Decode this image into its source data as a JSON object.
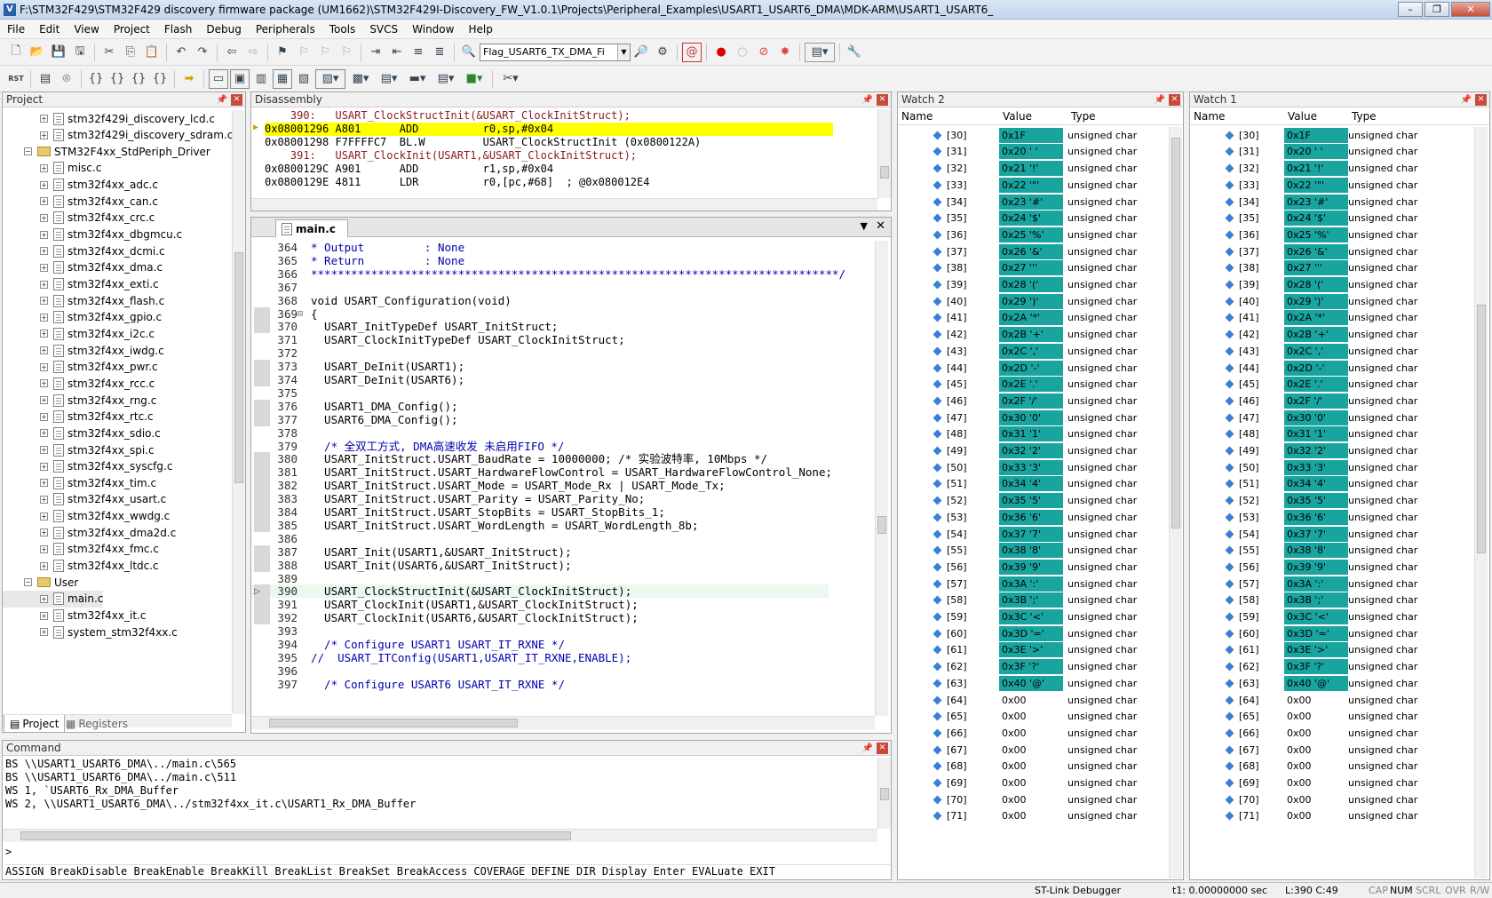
{
  "title": "F:\\STM32F429\\STM32F429 discovery firmware package (UM1662)\\STM32F429I-Discovery_FW_V1.0.1\\Projects\\Peripheral_Examples\\USART1_USART6_DMA\\MDK-ARM\\USART1_USART6_",
  "menu": [
    "File",
    "Edit",
    "View",
    "Project",
    "Flash",
    "Debug",
    "Peripherals",
    "Tools",
    "SVCS",
    "Window",
    "Help"
  ],
  "toolbar": {
    "target_combo": "Flag_USART6_TX_DMA_Fi",
    "rst_label": "RST"
  },
  "project": {
    "header": "Project",
    "items": [
      {
        "label": "stm32f429i_discovery_lcd.c",
        "kind": "file",
        "level": 2
      },
      {
        "label": "stm32f429i_discovery_sdram.c",
        "kind": "file",
        "level": 2
      },
      {
        "label": "STM32F4xx_StdPeriph_Driver",
        "kind": "folder",
        "level": 1
      },
      {
        "label": "misc.c",
        "kind": "file",
        "level": 2
      },
      {
        "label": "stm32f4xx_adc.c",
        "kind": "file",
        "level": 2
      },
      {
        "label": "stm32f4xx_can.c",
        "kind": "file",
        "level": 2
      },
      {
        "label": "stm32f4xx_crc.c",
        "kind": "file",
        "level": 2
      },
      {
        "label": "stm32f4xx_dbgmcu.c",
        "kind": "file",
        "level": 2
      },
      {
        "label": "stm32f4xx_dcmi.c",
        "kind": "file",
        "level": 2
      },
      {
        "label": "stm32f4xx_dma.c",
        "kind": "file",
        "level": 2
      },
      {
        "label": "stm32f4xx_exti.c",
        "kind": "file",
        "level": 2
      },
      {
        "label": "stm32f4xx_flash.c",
        "kind": "file",
        "level": 2
      },
      {
        "label": "stm32f4xx_gpio.c",
        "kind": "file",
        "level": 2
      },
      {
        "label": "stm32f4xx_i2c.c",
        "kind": "file",
        "level": 2
      },
      {
        "label": "stm32f4xx_iwdg.c",
        "kind": "file",
        "level": 2
      },
      {
        "label": "stm32f4xx_pwr.c",
        "kind": "file",
        "level": 2
      },
      {
        "label": "stm32f4xx_rcc.c",
        "kind": "file",
        "level": 2
      },
      {
        "label": "stm32f4xx_rng.c",
        "kind": "file",
        "level": 2
      },
      {
        "label": "stm32f4xx_rtc.c",
        "kind": "file",
        "level": 2
      },
      {
        "label": "stm32f4xx_sdio.c",
        "kind": "file",
        "level": 2
      },
      {
        "label": "stm32f4xx_spi.c",
        "kind": "file",
        "level": 2
      },
      {
        "label": "stm32f4xx_syscfg.c",
        "kind": "file",
        "level": 2
      },
      {
        "label": "stm32f4xx_tim.c",
        "kind": "file",
        "level": 2
      },
      {
        "label": "stm32f4xx_usart.c",
        "kind": "file",
        "level": 2
      },
      {
        "label": "stm32f4xx_wwdg.c",
        "kind": "file",
        "level": 2
      },
      {
        "label": "stm32f4xx_dma2d.c",
        "kind": "file",
        "level": 2
      },
      {
        "label": "stm32f4xx_fmc.c",
        "kind": "file",
        "level": 2
      },
      {
        "label": "stm32f4xx_ltdc.c",
        "kind": "file",
        "level": 2
      },
      {
        "label": "User",
        "kind": "folder",
        "level": 1
      },
      {
        "label": "main.c",
        "kind": "file",
        "level": 2
      },
      {
        "label": "stm32f4xx_it.c",
        "kind": "file",
        "level": 2
      },
      {
        "label": "system_stm32f4xx.c",
        "kind": "file",
        "level": 2
      }
    ],
    "tab_project": "Project",
    "tab_registers": "Registers"
  },
  "disassembly": {
    "header": "Disassembly",
    "lines": [
      {
        "text": "    390:   USART_ClockStructInit(&USART_ClockInitStruct);",
        "src": true,
        "hl": false
      },
      {
        "text": "0x08001296 A801      ADD          r0,sp,#0x04",
        "src": false,
        "hl": true
      },
      {
        "text": "0x08001298 F7FFFFC7  BL.W         USART_ClockStructInit (0x0800122A)",
        "src": false,
        "hl": false
      },
      {
        "text": "    391:   USART_ClockInit(USART1,&USART_ClockInitStruct);",
        "src": true,
        "hl": false
      },
      {
        "text": "0x0800129C A901      ADD          r1,sp,#0x04",
        "src": false,
        "hl": false
      },
      {
        "text": "0x0800129E 4811      LDR          r0,[pc,#68]  ; @0x080012E4",
        "src": false,
        "hl": false
      }
    ]
  },
  "editor": {
    "tab": "main.c",
    "lines": [
      {
        "n": "364",
        "t": "* Output         : None",
        "c": "#0000b0"
      },
      {
        "n": "365",
        "t": "* Return         : None",
        "c": "#0000b0"
      },
      {
        "n": "366",
        "t": "*******************************************************************************/",
        "c": "#0000b0"
      },
      {
        "n": "367",
        "t": "",
        "c": "#000"
      },
      {
        "n": "368",
        "t": "void USART_Configuration(void)",
        "c": "#000"
      },
      {
        "n": "369",
        "t": "{",
        "c": "#000"
      },
      {
        "n": "370",
        "t": "  USART_InitTypeDef USART_InitStruct;",
        "c": "#000"
      },
      {
        "n": "371",
        "t": "  USART_ClockInitTypeDef USART_ClockInitStruct;",
        "c": "#000"
      },
      {
        "n": "372",
        "t": "",
        "c": "#000"
      },
      {
        "n": "373",
        "t": "  USART_DeInit(USART1);",
        "c": "#000"
      },
      {
        "n": "374",
        "t": "  USART_DeInit(USART6);",
        "c": "#000"
      },
      {
        "n": "375",
        "t": "",
        "c": "#000"
      },
      {
        "n": "376",
        "t": "  USART1_DMA_Config();",
        "c": "#000"
      },
      {
        "n": "377",
        "t": "  USART6_DMA_Config();",
        "c": "#000"
      },
      {
        "n": "378",
        "t": "",
        "c": "#000"
      },
      {
        "n": "379",
        "t": "  /* 全双工方式, DMA高速收发 未启用FIFO */",
        "c": "#0000b0"
      },
      {
        "n": "380",
        "t": "  USART_InitStruct.USART_BaudRate = 10000000; /* 实验波特率, 10Mbps */",
        "c": "#000"
      },
      {
        "n": "381",
        "t": "  USART_InitStruct.USART_HardwareFlowControl = USART_HardwareFlowControl_None;",
        "c": "#000"
      },
      {
        "n": "382",
        "t": "  USART_InitStruct.USART_Mode = USART_Mode_Rx | USART_Mode_Tx;",
        "c": "#000"
      },
      {
        "n": "383",
        "t": "  USART_InitStruct.USART_Parity = USART_Parity_No;",
        "c": "#000"
      },
      {
        "n": "384",
        "t": "  USART_InitStruct.USART_StopBits = USART_StopBits_1;",
        "c": "#000"
      },
      {
        "n": "385",
        "t": "  USART_InitStruct.USART_WordLength = USART_WordLength_8b;",
        "c": "#000"
      },
      {
        "n": "386",
        "t": "",
        "c": "#000"
      },
      {
        "n": "387",
        "t": "  USART_Init(USART1,&USART_InitStruct);",
        "c": "#000"
      },
      {
        "n": "388",
        "t": "  USART_Init(USART6,&USART_InitStruct);",
        "c": "#000"
      },
      {
        "n": "389",
        "t": "",
        "c": "#000"
      },
      {
        "n": "390",
        "t": "  USART_ClockStructInit(&USART_ClockInitStruct);",
        "c": "#000"
      },
      {
        "n": "391",
        "t": "  USART_ClockInit(USART1,&USART_ClockInitStruct);",
        "c": "#000"
      },
      {
        "n": "392",
        "t": "  USART_ClockInit(USART6,&USART_ClockInitStruct);",
        "c": "#000"
      },
      {
        "n": "393",
        "t": "",
        "c": "#000"
      },
      {
        "n": "394",
        "t": "  /* Configure USART1 USART_IT_RXNE */",
        "c": "#0000b0"
      },
      {
        "n": "395",
        "t": "//  USART_ITConfig(USART1,USART_IT_RXNE,ENABLE);",
        "c": "#0000b0"
      },
      {
        "n": "396",
        "t": "",
        "c": "#000"
      },
      {
        "n": "397",
        "t": "  /* Configure USART6 USART_IT_RXNE */",
        "c": "#0000b0"
      }
    ]
  },
  "command": {
    "header": "Command",
    "lines": [
      "BS \\\\USART1_USART6_DMA\\../main.c\\565",
      "BS \\\\USART1_USART6_DMA\\../main.c\\511",
      "WS 1, `USART6_Rx_DMA_Buffer",
      "WS 2, \\\\USART1_USART6_DMA\\../stm32f4xx_it.c\\USART1_Rx_DMA_Buffer"
    ],
    "prompt": ">",
    "help": "ASSIGN BreakDisable BreakEnable BreakKill BreakList BreakSet BreakAccess COVERAGE DEFINE DIR Display Enter EVALuate EXIT"
  },
  "watch2": {
    "header": "Watch 2",
    "col_name": "Name",
    "col_value": "Value",
    "col_type": "Type"
  },
  "watch1": {
    "header": "Watch 1",
    "col_name": "Name",
    "col_value": "Value",
    "col_type": "Type"
  },
  "watch_rows": [
    {
      "i": "[30]",
      "v": "0x1F",
      "t": "unsigned char",
      "ch": true
    },
    {
      "i": "[31]",
      "v": "0x20 ' '",
      "t": "unsigned char",
      "ch": true
    },
    {
      "i": "[32]",
      "v": "0x21 '!'",
      "t": "unsigned char",
      "ch": true
    },
    {
      "i": "[33]",
      "v": "0x22 '\"'",
      "t": "unsigned char",
      "ch": true
    },
    {
      "i": "[34]",
      "v": "0x23 '#'",
      "t": "unsigned char",
      "ch": true
    },
    {
      "i": "[35]",
      "v": "0x24 '$'",
      "t": "unsigned char",
      "ch": true
    },
    {
      "i": "[36]",
      "v": "0x25 '%'",
      "t": "unsigned char",
      "ch": true
    },
    {
      "i": "[37]",
      "v": "0x26 '&'",
      "t": "unsigned char",
      "ch": true
    },
    {
      "i": "[38]",
      "v": "0x27 '''",
      "t": "unsigned char",
      "ch": true
    },
    {
      "i": "[39]",
      "v": "0x28 '('",
      "t": "unsigned char",
      "ch": true
    },
    {
      "i": "[40]",
      "v": "0x29 ')'",
      "t": "unsigned char",
      "ch": true
    },
    {
      "i": "[41]",
      "v": "0x2A '*'",
      "t": "unsigned char",
      "ch": true
    },
    {
      "i": "[42]",
      "v": "0x2B '+'",
      "t": "unsigned char",
      "ch": true
    },
    {
      "i": "[43]",
      "v": "0x2C ','",
      "t": "unsigned char",
      "ch": true
    },
    {
      "i": "[44]",
      "v": "0x2D '-'",
      "t": "unsigned char",
      "ch": true
    },
    {
      "i": "[45]",
      "v": "0x2E '.'",
      "t": "unsigned char",
      "ch": true
    },
    {
      "i": "[46]",
      "v": "0x2F '/'",
      "t": "unsigned char",
      "ch": true
    },
    {
      "i": "[47]",
      "v": "0x30 '0'",
      "t": "unsigned char",
      "ch": true
    },
    {
      "i": "[48]",
      "v": "0x31 '1'",
      "t": "unsigned char",
      "ch": true
    },
    {
      "i": "[49]",
      "v": "0x32 '2'",
      "t": "unsigned char",
      "ch": true
    },
    {
      "i": "[50]",
      "v": "0x33 '3'",
      "t": "unsigned char",
      "ch": true
    },
    {
      "i": "[51]",
      "v": "0x34 '4'",
      "t": "unsigned char",
      "ch": true
    },
    {
      "i": "[52]",
      "v": "0x35 '5'",
      "t": "unsigned char",
      "ch": true
    },
    {
      "i": "[53]",
      "v": "0x36 '6'",
      "t": "unsigned char",
      "ch": true
    },
    {
      "i": "[54]",
      "v": "0x37 '7'",
      "t": "unsigned char",
      "ch": true
    },
    {
      "i": "[55]",
      "v": "0x38 '8'",
      "t": "unsigned char",
      "ch": true
    },
    {
      "i": "[56]",
      "v": "0x39 '9'",
      "t": "unsigned char",
      "ch": true
    },
    {
      "i": "[57]",
      "v": "0x3A ':'",
      "t": "unsigned char",
      "ch": true
    },
    {
      "i": "[58]",
      "v": "0x3B ';'",
      "t": "unsigned char",
      "ch": true
    },
    {
      "i": "[59]",
      "v": "0x3C '<'",
      "t": "unsigned char",
      "ch": true
    },
    {
      "i": "[60]",
      "v": "0x3D '='",
      "t": "unsigned char",
      "ch": true
    },
    {
      "i": "[61]",
      "v": "0x3E '>'",
      "t": "unsigned char",
      "ch": true
    },
    {
      "i": "[62]",
      "v": "0x3F '?'",
      "t": "unsigned char",
      "ch": true
    },
    {
      "i": "[63]",
      "v": "0x40 '@'",
      "t": "unsigned char",
      "ch": true
    },
    {
      "i": "[64]",
      "v": "0x00",
      "t": "unsigned char",
      "ch": false
    },
    {
      "i": "[65]",
      "v": "0x00",
      "t": "unsigned char",
      "ch": false
    },
    {
      "i": "[66]",
      "v": "0x00",
      "t": "unsigned char",
      "ch": false
    },
    {
      "i": "[67]",
      "v": "0x00",
      "t": "unsigned char",
      "ch": false
    },
    {
      "i": "[68]",
      "v": "0x00",
      "t": "unsigned char",
      "ch": false
    },
    {
      "i": "[69]",
      "v": "0x00",
      "t": "unsigned char",
      "ch": false
    },
    {
      "i": "[70]",
      "v": "0x00",
      "t": "unsigned char",
      "ch": false
    },
    {
      "i": "[71]",
      "v": "0x00",
      "t": "unsigned char",
      "ch": false
    }
  ],
  "colors": {
    "changed_value": "#1aa4a0",
    "current_line": "#ffff00",
    "comment": "#0000b0"
  },
  "status": {
    "debugger": "ST-Link Debugger",
    "time": "t1: 0.00000000 sec",
    "pos": "L:390 C:49",
    "caps": "CAP",
    "num": "NUM",
    "scrl": "SCRL",
    "ovr": "OVR",
    "rw": "R/W"
  }
}
